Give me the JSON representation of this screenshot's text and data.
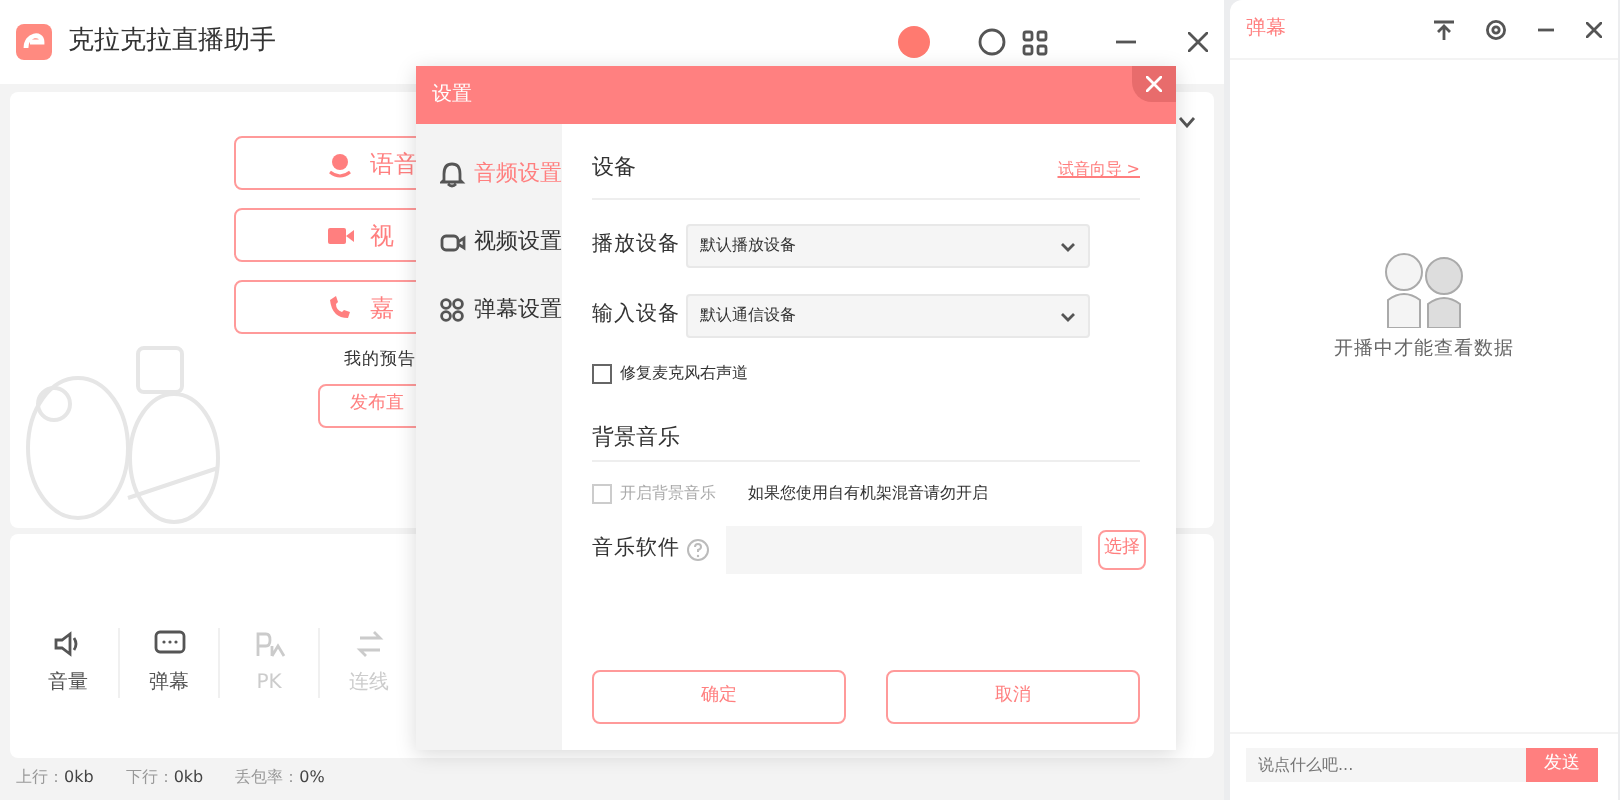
{
  "app": {
    "title": "克拉克拉直播助手"
  },
  "main": {
    "mode_buttons": [
      {
        "label": "语音",
        "kind": "mic"
      },
      {
        "label": "视",
        "kind": "video"
      },
      {
        "label": "嘉",
        "kind": "phone"
      }
    ],
    "notice": "我的预告",
    "publish_button": "发布直"
  },
  "toolbar": [
    {
      "label": "音量",
      "kind": "volume",
      "disabled": false
    },
    {
      "label": "弹幕",
      "kind": "chat",
      "disabled": false
    },
    {
      "label": "PK",
      "kind": "pk",
      "disabled": true
    },
    {
      "label": "连线",
      "kind": "link",
      "disabled": true
    }
  ],
  "status_bar": [
    {
      "label": "上行：",
      "value": "0kb"
    },
    {
      "label": "下行：",
      "value": "0kb"
    },
    {
      "label": "丢包率：",
      "value": "0%"
    }
  ],
  "settings_dialog": {
    "title": "设置",
    "tabs": [
      {
        "label": "音频设置",
        "kind": "audio",
        "selected": true
      },
      {
        "label": "视频设置",
        "kind": "video",
        "selected": false
      },
      {
        "label": "弹幕设置",
        "kind": "grid",
        "selected": false
      }
    ],
    "device_heading": "设备",
    "test_link": "试音向导 >",
    "selects": [
      {
        "label": "播放设备",
        "value": "默认播放设备"
      },
      {
        "label": "输入设备",
        "value": "默认通信设备"
      }
    ],
    "fix_channel": {
      "label": "修复麦克风右声道",
      "checked": false,
      "disabled": false
    },
    "music_heading": "背景音乐",
    "bg_music": {
      "label": "开启背景音乐",
      "checked": false,
      "disabled": true
    },
    "bg_music_note": "如果您使用自有机架混音请勿开启",
    "music_software": {
      "label": "音乐软件"
    },
    "choose_button": "选择",
    "ok_button": "确定",
    "cancel_button": "取消"
  },
  "danmu_panel": {
    "title": "弹幕",
    "empty_text": "开播中才能查看数据",
    "input": {
      "placeholder": "说点什么吧..."
    },
    "send_button": "发送"
  }
}
